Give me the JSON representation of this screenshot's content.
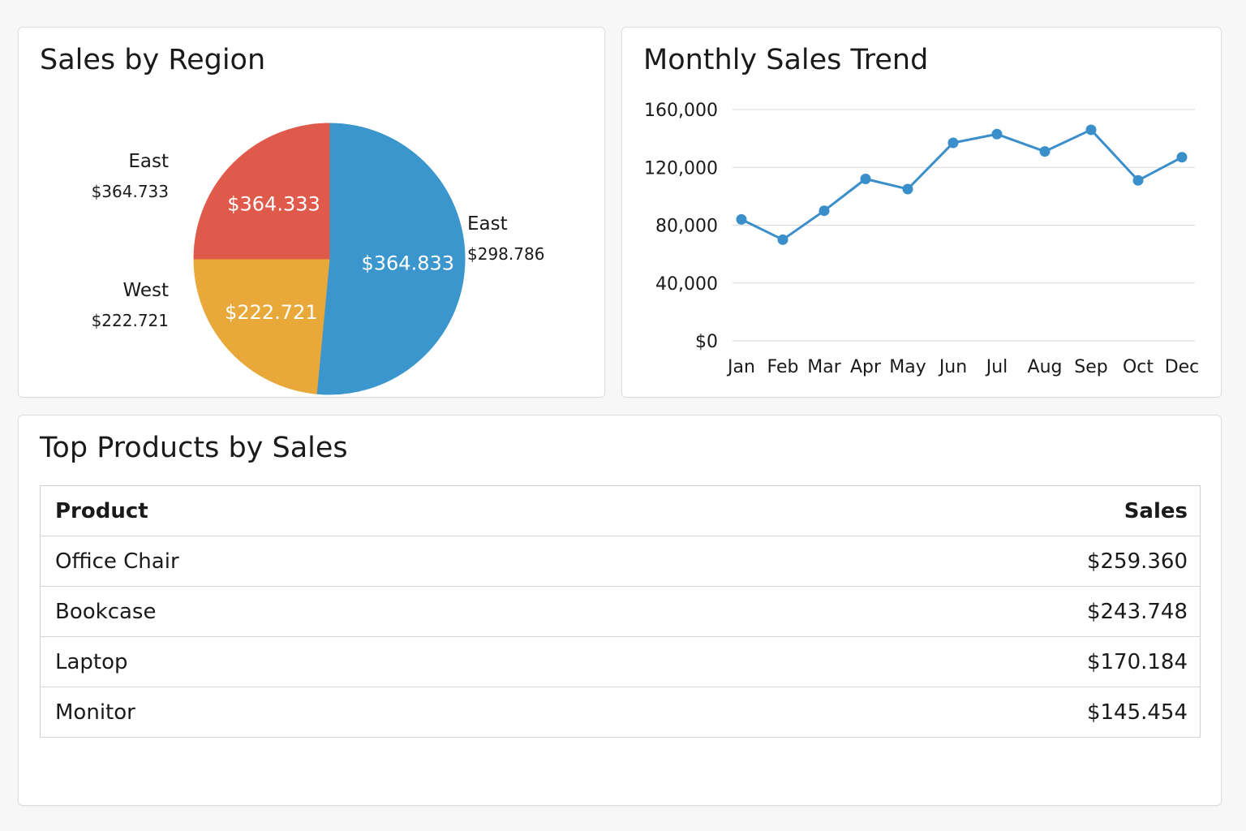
{
  "region_card": {
    "title": "Sales by Region"
  },
  "trend_card": {
    "title": "Monthly Sales Trend"
  },
  "products_card": {
    "title": "Top Products by Sales",
    "columns": [
      "Product",
      "Sales"
    ],
    "rows": [
      {
        "product": "Office Chair",
        "sales": "$259.360"
      },
      {
        "product": "Bookcase",
        "sales": "$243.748"
      },
      {
        "product": "Laptop",
        "sales": "$170.184"
      },
      {
        "product": "Monitor",
        "sales": "$145.454"
      }
    ]
  },
  "chart_data": [
    {
      "type": "pie",
      "title": "Sales by Region",
      "slices": [
        {
          "label": "East",
          "value_label": "$298.786",
          "inner_label": "$364.833",
          "percent": 51.5,
          "color": "#3a96cd"
        },
        {
          "label": "West",
          "value_label": "$222.721",
          "inner_label": "$222.721",
          "percent": 23.5,
          "color": "#e8a83a"
        },
        {
          "label": "East",
          "value_label": "$364.733",
          "inner_label": "$364.333",
          "percent": 25.0,
          "color": "#e05a4b"
        }
      ]
    },
    {
      "type": "line",
      "title": "Monthly Sales Trend",
      "x": [
        "Jan",
        "Feb",
        "Mar",
        "Apr",
        "May",
        "Jun",
        "Jul",
        "Aug",
        "Sep",
        "Oct",
        "Dec"
      ],
      "series": [
        {
          "values": [
            84000,
            70000,
            90000,
            112000,
            105000,
            137000,
            143000,
            131000,
            146000,
            111000,
            127000
          ],
          "color": "#3a8fcb"
        }
      ],
      "ylim": [
        0,
        160000
      ],
      "yticks": [
        0,
        40000,
        80000,
        120000,
        160000
      ],
      "ytick_labels": [
        "$0",
        "40,000",
        "80,000",
        "120,000",
        "160,000"
      ],
      "grid": true
    }
  ]
}
